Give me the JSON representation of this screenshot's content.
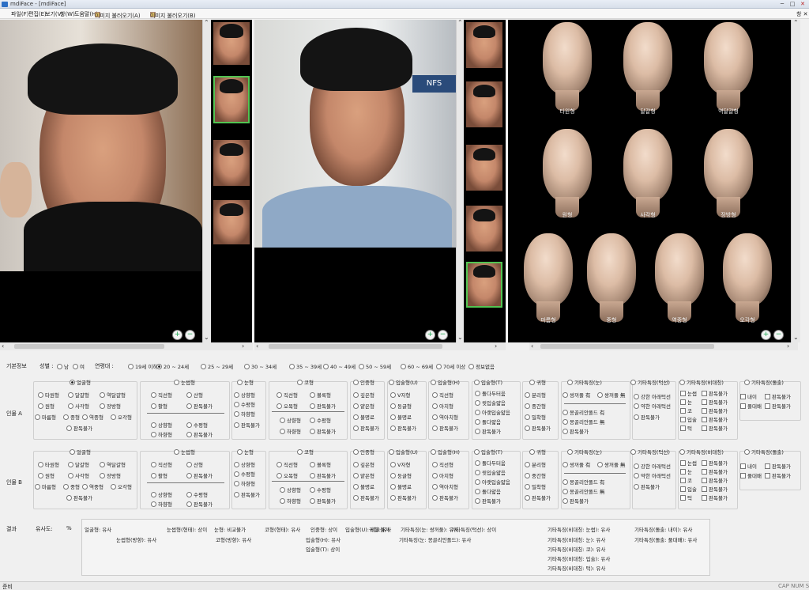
{
  "window": {
    "title": "mdiFace - [mdiFace]",
    "min": "─",
    "max": "□",
    "close": "✕"
  },
  "menu": [
    "파일(F)",
    "편집(E)",
    "보기(V)",
    "창(W)",
    "도움말(H)",
    "이미지 불러오기(A)",
    "이미지 불러오기(B)"
  ],
  "panel_close": "창 ✕",
  "face_labels": [
    "타원형",
    "달걀형",
    "역달걀형",
    "원형",
    "사각형",
    "장방형",
    "마름형",
    "중형",
    "역중형",
    "오각형"
  ],
  "basic": {
    "label": "기본정보",
    "sex_label": "성별 :",
    "sex": [
      "남",
      "여"
    ],
    "age_label": "연령대 :",
    "ages": [
      "19세 이하",
      "20 ~ 24세",
      "25 ~ 29세",
      "30 ~ 34세",
      "35 ~ 39세",
      "40 ~ 49세",
      "50 ~ 59세",
      "60 ~ 69세",
      "70세 이상",
      "정보없음"
    ],
    "selected_age": "20 ~ 24세"
  },
  "personA": {
    "label": "인물 A"
  },
  "personB": {
    "label": "인물 B"
  },
  "face_shape": {
    "title": "얼굴형",
    "opts": [
      "타원형",
      "달걀형",
      "역달걀형",
      "원형",
      "사각형",
      "장방형",
      "마름형",
      "중형",
      "역중형",
      "오각형",
      "판독불가"
    ]
  },
  "eye_shape": {
    "title": "눈썹형",
    "opts": [
      "직선형",
      "산형",
      "활형",
      "판독불가",
      "상향형",
      "수평형",
      "하향형",
      "판독불가"
    ]
  },
  "eye": {
    "title": "눈형",
    "opts": [
      "상향형",
      "수평형",
      "하향형",
      "판독불가"
    ]
  },
  "nose": {
    "title": "코형",
    "opts": [
      "직선형",
      "볼록형",
      "오목형",
      "판독불가",
      "상향형",
      "수평형",
      "하향형",
      "판독불가"
    ]
  },
  "philtrum": {
    "title": "인중형",
    "opts": [
      "깊은형",
      "얕은형",
      "불명료",
      "판독불가"
    ]
  },
  "lipU": {
    "title": "입술형(U)",
    "opts": [
      "V자형",
      "둥글형",
      "불명료",
      "판독불가"
    ]
  },
  "lipH": {
    "title": "입술형(H)",
    "opts": [
      "직선형",
      "아치형",
      "역아치형",
      "판독불가"
    ]
  },
  "lipT": {
    "title": "입술형(T)",
    "opts": [
      "돌다두터움",
      "윗입술얇음",
      "아랫입술얇음",
      "돌다얇음",
      "판독불가"
    ]
  },
  "ear": {
    "title": "귀형",
    "opts": [
      "분리형",
      "중간형",
      "밀착형",
      "판독불가"
    ]
  },
  "other_eye": {
    "title": "기타특징(눈)",
    "opts": [
      "쌍꺼풀 有",
      "쌍꺼풀 無",
      "몽골리안폴드 有",
      "몽골리안폴드 無",
      "판독불가"
    ]
  },
  "other_chin": {
    "title": "기타특징(턱선)",
    "opts": [
      "강한 아래턱선",
      "약한 아래턱선",
      "판독불가"
    ]
  },
  "other_asym": {
    "title": "기타특징(비대칭)",
    "opts": [
      "눈썹",
      "눈",
      "코",
      "입술",
      "턱"
    ],
    "na": "판독불가"
  },
  "other_bump": {
    "title": "기타특징(돌출)",
    "opts": [
      "내이",
      "풀대배"
    ],
    "na": "판독불가"
  },
  "result": {
    "label": "결과",
    "sim_label": "유사도:",
    "sim_unit": "%",
    "lines": [
      "얼굴형: 유사",
      "눈썹형(형태): 상이",
      "눈형: 비교불가",
      "코형(형태): 유사",
      "인중형: 상이",
      "입술형(U): 비교불가",
      "귀형: 유사",
      "기타특징(눈: 쌍꺼풀): 유사",
      "기타특징(턱선): 상이",
      "기타특징(비대칭: 눈썹): 유사",
      "기타특징(돌출: 내이): 유사",
      "눈썹형(방향): 유사",
      "코형(방향): 유사",
      "입술형(H): 유사",
      "기타특징(눈: 몽골리안폴드): 유사",
      "기타특징(비대칭: 눈): 유사",
      "기타특징(돌출: 풀대배): 유사",
      "입술형(T): 상이",
      "기타특징(비대칭: 코): 유사",
      "기타특징(비대칭: 입술): 유사",
      "기타특징(비대칭: 턱): 유사"
    ]
  },
  "status": {
    "left": "준비",
    "right": "CAP  NUM  SCRL"
  }
}
